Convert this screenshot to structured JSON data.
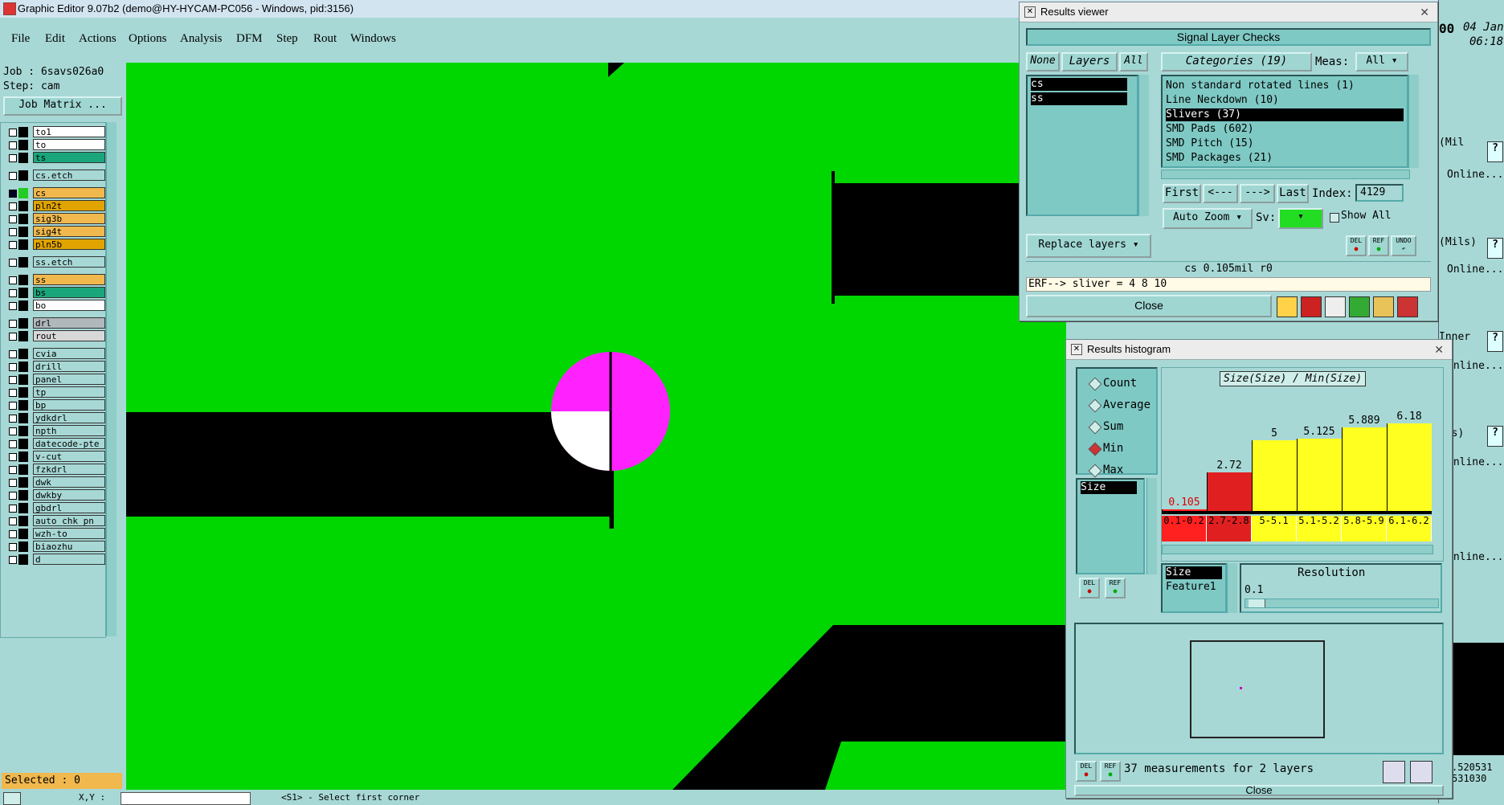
{
  "window_title": "Graphic Editor 9.07b2 (demo@HY-HYCAM-PC056 - Windows, pid:3156)",
  "menu": [
    "File",
    "Edit",
    "Actions",
    "Options",
    "Analysis",
    "DFM",
    "Step",
    "Rout",
    "Windows"
  ],
  "job": {
    "job_label": "Job : 6savs026a0",
    "step_label": "Step: cam",
    "matrix_button": "Job Matrix ..."
  },
  "layers": [
    {
      "name": "to1",
      "color": "#ffffff"
    },
    {
      "name": "to",
      "color": "#ffffff"
    },
    {
      "name": "ts",
      "color": "#1aa67a"
    },
    {
      "name": "cs.etch",
      "color": "#a7d8d5"
    },
    {
      "name": "cs",
      "color": "#f0b84d",
      "active": true
    },
    {
      "name": "pln2t",
      "color": "#e0a300"
    },
    {
      "name": "sig3b",
      "color": "#f0b84d"
    },
    {
      "name": "sig4t",
      "color": "#f0b84d"
    },
    {
      "name": "pln5b",
      "color": "#e0a300"
    },
    {
      "name": "ss.etch",
      "color": "#a7d8d5"
    },
    {
      "name": "ss",
      "color": "#f0b84d"
    },
    {
      "name": "bs",
      "color": "#1aa67a"
    },
    {
      "name": "bo",
      "color": "#ffffff"
    },
    {
      "name": "drl",
      "color": "#b0b8bc"
    },
    {
      "name": "rout",
      "color": "#d8d8d8"
    },
    {
      "name": "cvia",
      "color": "#a7d8d5"
    },
    {
      "name": "drill",
      "color": "#a7d8d5"
    },
    {
      "name": "panel",
      "color": "#a7d8d5"
    },
    {
      "name": "tp",
      "color": "#a7d8d5"
    },
    {
      "name": "bp",
      "color": "#a7d8d5"
    },
    {
      "name": "ydkdrl",
      "color": "#a7d8d5"
    },
    {
      "name": "npth",
      "color": "#a7d8d5"
    },
    {
      "name": "datecode-pte",
      "color": "#a7d8d5"
    },
    {
      "name": "v-cut",
      "color": "#a7d8d5"
    },
    {
      "name": "fzkdrl",
      "color": "#a7d8d5"
    },
    {
      "name": "dwk",
      "color": "#a7d8d5"
    },
    {
      "name": "dwkby",
      "color": "#a7d8d5"
    },
    {
      "name": "gbdrl",
      "color": "#a7d8d5"
    },
    {
      "name": "auto_chk_pn",
      "color": "#a7d8d5"
    },
    {
      "name": "wzh-to",
      "color": "#a7d8d5"
    },
    {
      "name": "biaozhu",
      "color": "#a7d8d5"
    },
    {
      "name": "d",
      "color": "#a7d8d5"
    }
  ],
  "selected_label": "Selected : 0",
  "status": {
    "prompt": "<S1> - Select first corner",
    "xy_label": "X,Y :"
  },
  "results_viewer": {
    "title": "Results viewer",
    "header": "Signal Layer Checks",
    "none_btn": "None",
    "layers_btn": "Layers",
    "all_btn": "All",
    "layers": [
      "cs",
      "ss"
    ],
    "categories_label": "Categories (19)",
    "meas_label": "Meas:",
    "meas_value": "All",
    "categories": [
      "Non standard rotated lines (1)",
      "Line Neckdown (10)",
      "Slivers (37)",
      "SMD Pads (602)",
      "SMD Pitch (15)",
      "SMD Packages (21)"
    ],
    "selected_category": 2,
    "first_btn": "First",
    "prev_btn": "<---",
    "next_btn": "--->",
    "last_btn": "Last",
    "index_label": "Index:",
    "index_value": "4129",
    "auto_zoom": "Auto Zoom",
    "sv_label": "Sv:",
    "show_all": "Show All",
    "replace_layers": "Replace layers",
    "del_label": "DEL",
    "ref_label": "REF",
    "undo_label": "UNDO",
    "info_line": "cs 0.105mil  r0",
    "erf_line": "ERF--> sliver = 4 8 10",
    "close": "Close"
  },
  "results_histogram": {
    "title": "Results histogram",
    "radios": [
      {
        "label": "Count",
        "on": false
      },
      {
        "label": "Average",
        "on": false
      },
      {
        "label": "Sum",
        "on": false
      },
      {
        "label": "Min",
        "on": true
      },
      {
        "label": "Max",
        "on": false
      }
    ],
    "attr_list": [
      "Size"
    ],
    "chart_title": "Size(Size) / Min(Size)",
    "del_label": "DEL",
    "ref_label": "REF",
    "field_list": [
      "Size",
      "Feature1"
    ],
    "resolution_label": "Resolution",
    "resolution_value": "0.1",
    "summary": "37 measurements for 2 layers",
    "close": "Close"
  },
  "chart_data": {
    "type": "bar",
    "title": "Size(Size) / Min(Size)",
    "categories": [
      "0.1-0.2",
      "2.7-2.8",
      "5-5.1",
      "5.1-5.2",
      "5.8-5.9",
      "6.1-6.2"
    ],
    "values": [
      0.105,
      2.72,
      5,
      5.125,
      5.889,
      6.18
    ],
    "value_labels": [
      "0.105",
      "2.72",
      "5",
      "5.125",
      "5.889",
      "6.18"
    ],
    "colors": [
      "#ff2020",
      "#e02020",
      "#ffff20",
      "#ffff20",
      "#ffff20",
      "#ffff20"
    ],
    "ylim": [
      0,
      6.6
    ]
  },
  "right_partial": {
    "texts": [
      "00",
      "04 Jan",
      "06:18",
      "(Mil",
      "Online...",
      "(Mils)",
      "Online...",
      "Inner",
      "Online...",
      "ils)",
      "Online...",
      "Online...",
      ".520531",
      "531030"
    ]
  },
  "colors": {
    "panel": "#a7d8d5",
    "canvas": "#00d700",
    "pad": "#ff22ff",
    "selection": "#000000"
  }
}
